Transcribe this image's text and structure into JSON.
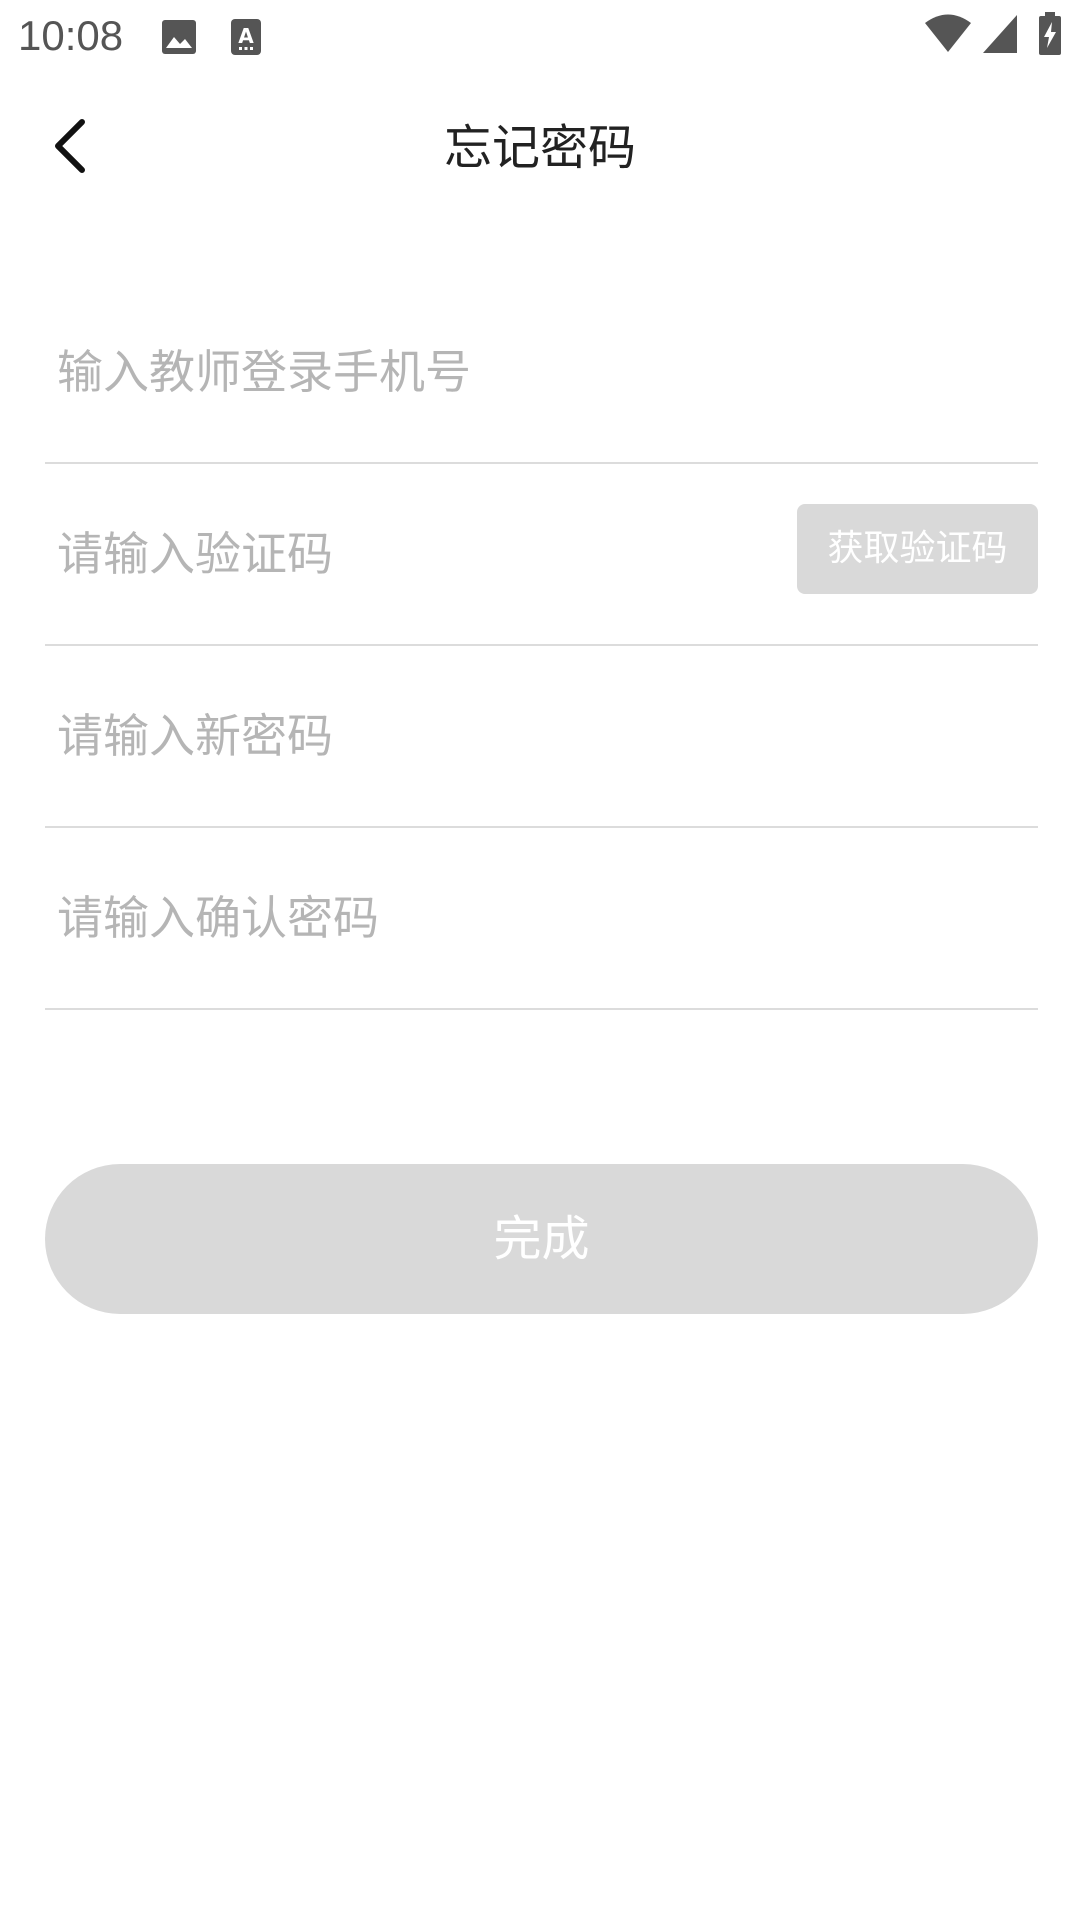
{
  "status_bar": {
    "time": "10:08",
    "icons": [
      "image-icon",
      "keyboard-a-icon",
      "wifi-icon",
      "cell-signal-icon",
      "battery-charging-icon"
    ]
  },
  "header": {
    "title": "忘记密码",
    "back_icon": "chevron-left-icon"
  },
  "form": {
    "phone": {
      "placeholder": "输入教师登录手机号",
      "value": ""
    },
    "code": {
      "placeholder": "请输入验证码",
      "value": "",
      "button_label": "获取验证码"
    },
    "new_password": {
      "placeholder": "请输入新密码",
      "value": ""
    },
    "confirm_password": {
      "placeholder": "请输入确认密码",
      "value": ""
    }
  },
  "submit": {
    "label": "完成"
  },
  "colors": {
    "disabled_button": "#d9d9d9",
    "placeholder": "#b5b5b5",
    "divider": "#dcdcdc",
    "title": "#222222"
  }
}
